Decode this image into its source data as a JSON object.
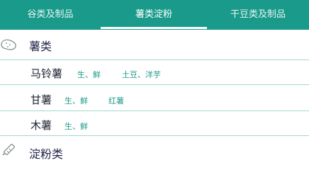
{
  "tabs": [
    {
      "label": "谷类及制品"
    },
    {
      "label": "薯类淀粉"
    },
    {
      "label": "干豆类及制品"
    }
  ],
  "categories": [
    {
      "title": "薯类",
      "icon": "potato-icon",
      "items": [
        {
          "name": "马铃薯",
          "tags": [
            "生、鲜",
            "土豆、洋芋"
          ]
        },
        {
          "name": "甘薯",
          "tags": [
            "生、鲜",
            "红薯"
          ]
        },
        {
          "name": "木薯",
          "tags": [
            "生、鲜"
          ]
        }
      ]
    },
    {
      "title": "淀粉类",
      "icon": "starch-tube-icon",
      "items": []
    }
  ],
  "colors": {
    "tab_bg": "#1a9a8a",
    "accent": "#1f9a88",
    "divider": "#9fd9d0"
  }
}
